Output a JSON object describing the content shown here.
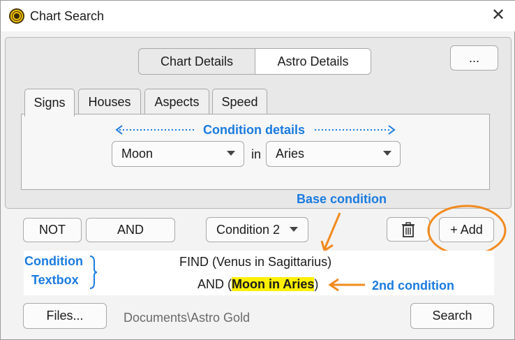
{
  "window": {
    "title": "Chart Search",
    "close_label": "✕"
  },
  "more_button": "...",
  "segmented": [
    "Chart Details",
    "Astro Details"
  ],
  "tabs": [
    "Signs",
    "Houses",
    "Aspects",
    "Speed"
  ],
  "condition_row": {
    "left_dropdown": "Moon",
    "connector": "in",
    "right_dropdown": "Aries"
  },
  "buttons": {
    "not": "NOT",
    "and": "AND",
    "condition_select": "Condition 2",
    "add": "+ Add",
    "files": "Files...",
    "search": "Search"
  },
  "condition_text": {
    "line1": "FIND (Venus in Sagittarius)",
    "line2_prefix": "AND (",
    "line2_highlight": "Moon in Aries",
    "line2_suffix": ")"
  },
  "path": "Documents\\Astro Gold",
  "annotations": {
    "condition_details": "Condition details",
    "base_condition": "Base condition",
    "condition_textbox_line1": "Condition",
    "condition_textbox_line2": "Textbox",
    "second_condition": "2nd condition"
  },
  "colors": {
    "annotation_blue": "#1a7be0",
    "annotation_orange": "#f28a1e",
    "highlight": "#ffef00"
  },
  "icons": {
    "app": "astro-wheel-icon",
    "delete": "trash-icon",
    "close": "close-icon",
    "dropdown": "chevron-down-icon"
  }
}
